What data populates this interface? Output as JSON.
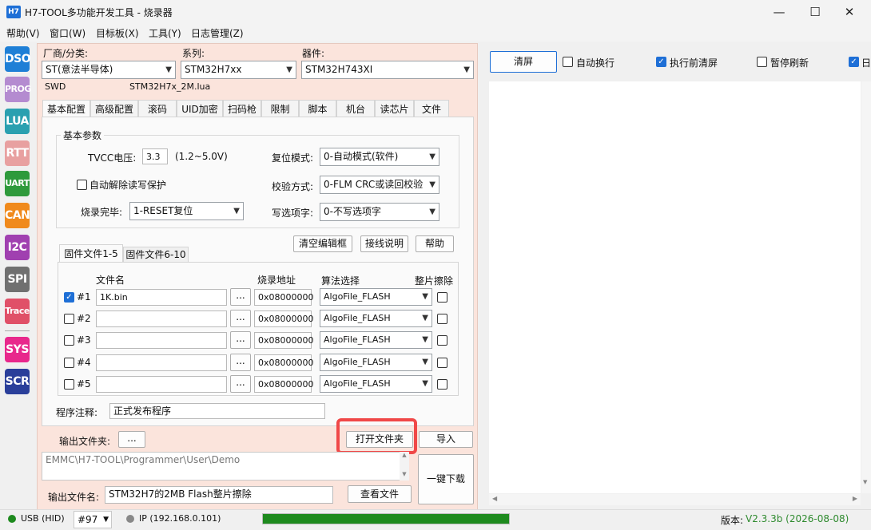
{
  "window": {
    "app_icon": "H7",
    "title": "H7-TOOL多功能开发工具 - 烧录器",
    "minimize": "—",
    "maximize": "☐",
    "close": "✕"
  },
  "menu": [
    "帮助(V)",
    "窗口(W)",
    "目标板(X)",
    "工具(Y)",
    "日志管理(Z)"
  ],
  "nav": [
    {
      "label": "DSO",
      "color": "#1e7fd6"
    },
    {
      "label": "PROG",
      "color": "#b48bd0"
    },
    {
      "label": "LUA",
      "color": "#2aa0b0"
    },
    {
      "label": "RTT",
      "color": "#e8a0a0"
    },
    {
      "label": "UART",
      "color": "#2e9a3c"
    },
    {
      "label": "CAN",
      "color": "#f08a1c"
    },
    {
      "label": "I2C",
      "color": "#a040b0"
    },
    {
      "label": "SPI",
      "color": "#707070"
    },
    {
      "label": "Trace",
      "color": "#e05068"
    },
    {
      "label": "SYS",
      "color": "#e8288c"
    },
    {
      "label": "SCR",
      "color": "#2a3f9a"
    }
  ],
  "device": {
    "vendor_label": "厂商/分类:",
    "vendor_value": "ST(意法半导体)",
    "series_label": "系列:",
    "series_value": "STM32H7xx",
    "part_label": "器件:",
    "part_value": "STM32H743XI",
    "interface": "SWD",
    "script": "STM32H7x_2M.lua"
  },
  "tabs": [
    "基本配置",
    "高级配置",
    "滚码",
    "UID加密",
    "扫码枪",
    "限制",
    "脚本",
    "机台",
    "读芯片",
    "文件"
  ],
  "basic": {
    "group_title": "基本参数",
    "tvcc_label": "TVCC电压:",
    "tvcc_value": "3.3",
    "tvcc_range": "(1.2~5.0V)",
    "reset_label": "复位模式:",
    "reset_value": "0-自动模式(软件)",
    "unprotect_label": "自动解除读写保护",
    "verify_label": "校验方式:",
    "verify_value": "0-FLM CRC或读回校验",
    "done_label": "烧录完毕:",
    "done_value": "1-RESET复位",
    "option_label": "写选项字:",
    "option_value": "0-不写选项字"
  },
  "actions": {
    "clear_editor": "清空编辑框",
    "wiring": "接线说明",
    "help": "帮助"
  },
  "file_tabs": [
    "固件文件1-5",
    "固件文件6-10"
  ],
  "file_table": {
    "headers": [
      "文件名",
      "烧录地址",
      "算法选择",
      "整片擦除"
    ],
    "browse": "...",
    "rows": [
      {
        "id": "#1",
        "checked": true,
        "file": "1K.bin",
        "addr": "0x08000000",
        "algo": "AlgoFile_FLASH",
        "erase": false
      },
      {
        "id": "#2",
        "checked": false,
        "file": "",
        "addr": "0x08000000",
        "algo": "AlgoFile_FLASH",
        "erase": false
      },
      {
        "id": "#3",
        "checked": false,
        "file": "",
        "addr": "0x08000000",
        "algo": "AlgoFile_FLASH",
        "erase": false
      },
      {
        "id": "#4",
        "checked": false,
        "file": "",
        "addr": "0x08000000",
        "algo": "AlgoFile_FLASH",
        "erase": false
      },
      {
        "id": "#5",
        "checked": false,
        "file": "",
        "addr": "0x08000000",
        "algo": "AlgoFile_FLASH",
        "erase": false
      }
    ]
  },
  "note": {
    "label": "程序注释:",
    "value": "正式发布程序"
  },
  "output": {
    "folder_label": "输出文件夹:",
    "folder_btn": "...",
    "open_folder": "打开文件夹",
    "import": "导入",
    "path": "EMMC\\H7-TOOL\\Programmer\\User\\Demo",
    "one_click": "一键下载",
    "name_label": "输出文件名:",
    "name_value": "STM32H7的2MB Flash整片擦除",
    "view_file": "查看文件"
  },
  "right": {
    "clear": "清屏",
    "auto_wrap": "自动换行",
    "clear_before": "执行前清屏",
    "pause_refresh": "暂停刷新",
    "log_cut": "日"
  },
  "status": {
    "usb": "USB (HID)",
    "device_no": "#97",
    "ip": "IP (192.168.0.101)",
    "progress": 1.0,
    "version_label": "版本:",
    "version_value": "V2.3.3b (2026-08-08)"
  },
  "colors": {
    "highlight_border": "#f04848",
    "progress": "#1e8a1e",
    "accent": "#1e6fd6"
  }
}
